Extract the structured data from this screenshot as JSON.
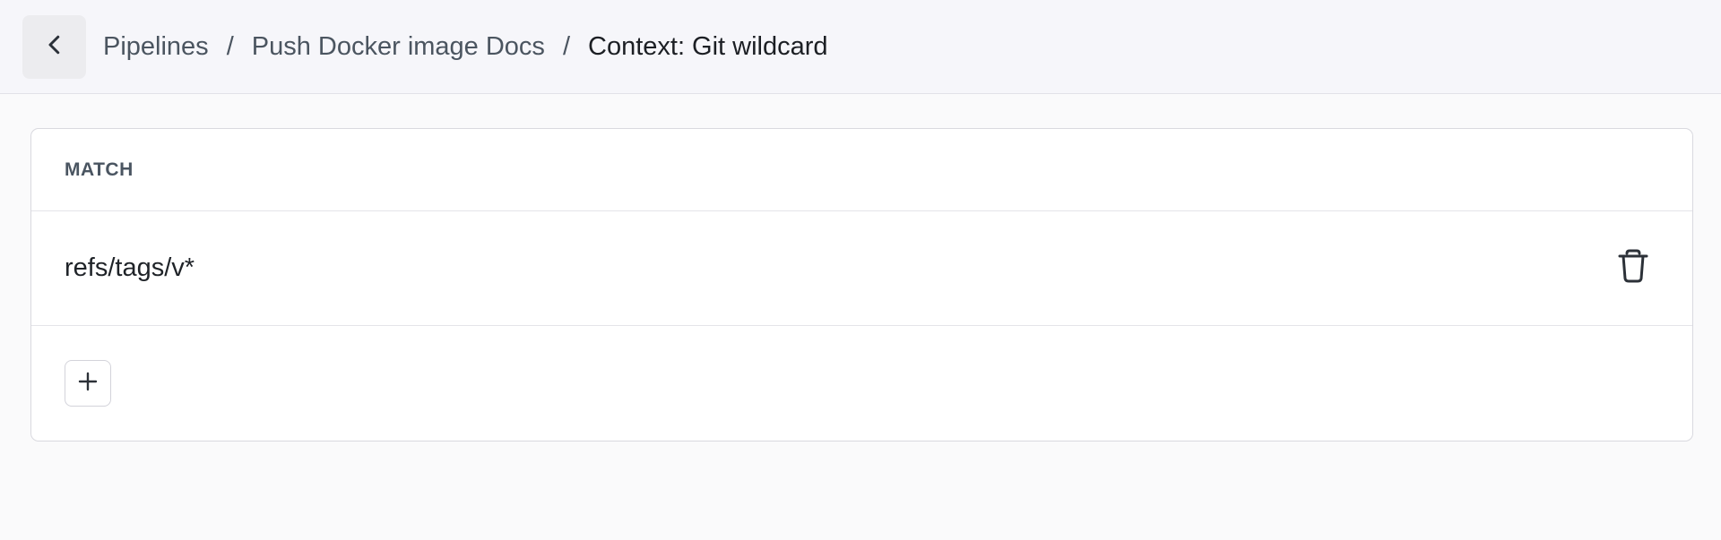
{
  "header": {
    "back_icon": "chevron-left-icon",
    "breadcrumb": {
      "items": [
        "Pipelines",
        "Push Docker image Docs"
      ],
      "separator": "/",
      "current": "Context: Git wildcard"
    }
  },
  "table": {
    "column_title": "MATCH",
    "rows": [
      {
        "value": "refs/tags/v*",
        "action_icon": "trash-icon"
      }
    ],
    "add_icon": "plus-icon"
  },
  "colors": {
    "header_bg": "#f6f6fa",
    "page_bg": "#fafafb",
    "text_primary": "#1f2328",
    "text_secondary": "#4b5560"
  }
}
